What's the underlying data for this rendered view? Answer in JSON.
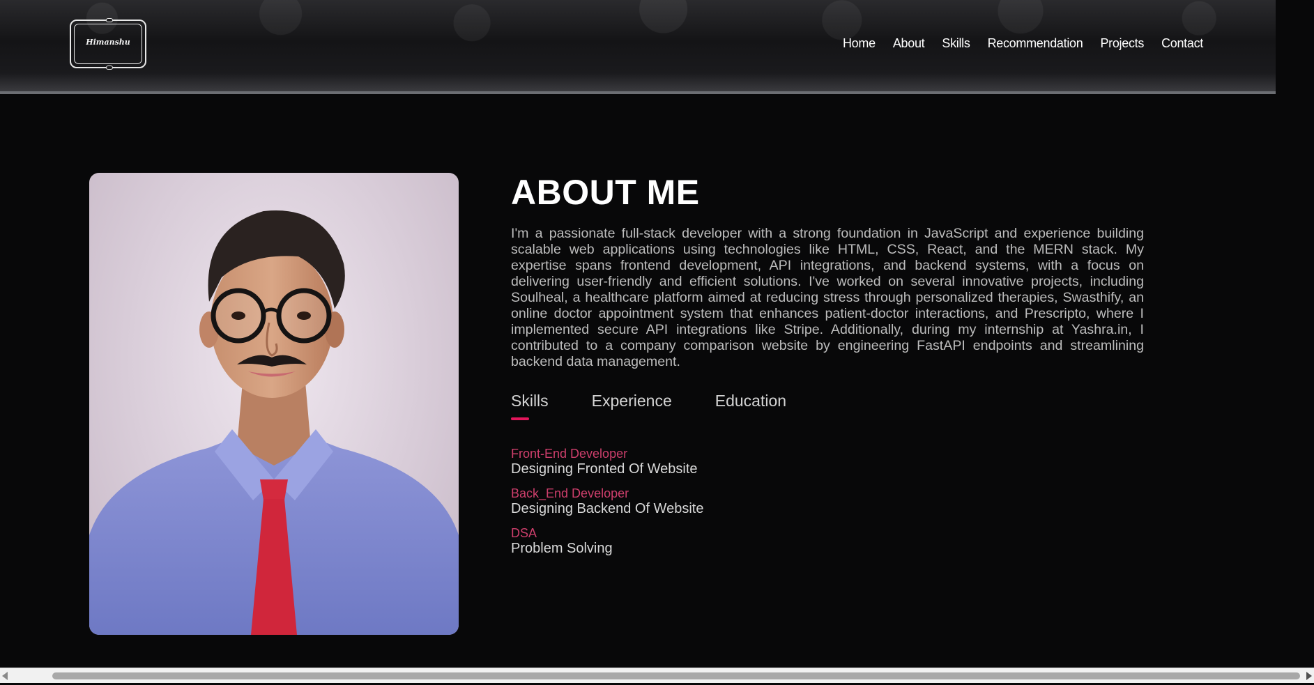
{
  "header": {
    "logo_text": "Himanshu",
    "nav": [
      "Home",
      "About",
      "Skills",
      "Recommendation",
      "Projects",
      "Contact"
    ]
  },
  "about": {
    "title": "ABOUT ME",
    "description": "I'm a passionate full-stack developer with a strong foundation in JavaScript and experience building scalable web applications using technologies like HTML, CSS, React, and the MERN stack. My expertise spans frontend development, API integrations, and backend systems, with a focus on delivering user-friendly and efficient solutions. I've worked on several innovative projects, including Soulheal, a healthcare platform aimed at reducing stress through personalized therapies, Swasthify, an online doctor appointment system that enhances patient-doctor interactions, and Prescripto, where I implemented secure API integrations like Stripe. Additionally, during my internship at Yashra.in, I contributed to a company comparison website by engineering FastAPI endpoints and streamlining backend data management.",
    "tabs": [
      "Skills",
      "Experience",
      "Education"
    ],
    "active_tab": "Skills",
    "skills": [
      {
        "title": "Front-End Developer",
        "desc": "Designing Fronted Of Website"
      },
      {
        "title": "Back_End Developer",
        "desc": "Designing Backend Of Website"
      },
      {
        "title": "DSA",
        "desc": "Problem Solving"
      }
    ]
  },
  "colors": {
    "accent": "#e3165b",
    "skill_title": "#ce3f6c",
    "background": "#080809"
  }
}
